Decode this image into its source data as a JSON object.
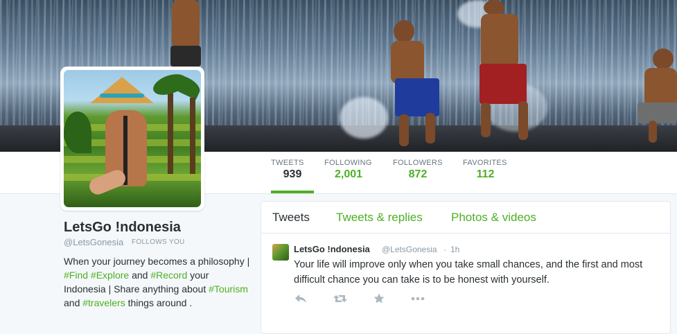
{
  "stats": [
    {
      "label": "TWEETS",
      "value": "939"
    },
    {
      "label": "FOLLOWING",
      "value": "2,001"
    },
    {
      "label": "FOLLOWERS",
      "value": "872"
    },
    {
      "label": "FAVORITES",
      "value": "112"
    }
  ],
  "profile": {
    "name": "LetsGo !ndonesia",
    "handle": "@LetsGonesia",
    "follows_you": "FOLLOWS YOU",
    "bio": {
      "p1": "When your journey becomes a philosophy | ",
      "tag1": "#Find",
      "sp1": " ",
      "tag2": "#Explore",
      "p2": " and ",
      "tag3": "#Record",
      "p3": " your Indonesia | Share anything about ",
      "tag4": "#Tourism",
      "p4": " and ",
      "tag5": "#travelers",
      "p5": " things around ."
    }
  },
  "timeline": {
    "tabs": [
      "Tweets",
      "Tweets & replies",
      "Photos & videos"
    ],
    "tweet": {
      "name": "LetsGo !ndonesia",
      "handle": "@LetsGonesia",
      "dot": "·",
      "time": "1h",
      "text": "Your life will improve only when you take small chances, and the first and most difficult chance you can take is to be honest with yourself."
    },
    "actions": [
      "reply-icon",
      "retweet-icon",
      "favorite-icon",
      "more-icon"
    ]
  },
  "colors": {
    "accent": "#4caf24",
    "text": "#292f33",
    "muted": "#8899a6",
    "icon": "#aab8c2"
  }
}
